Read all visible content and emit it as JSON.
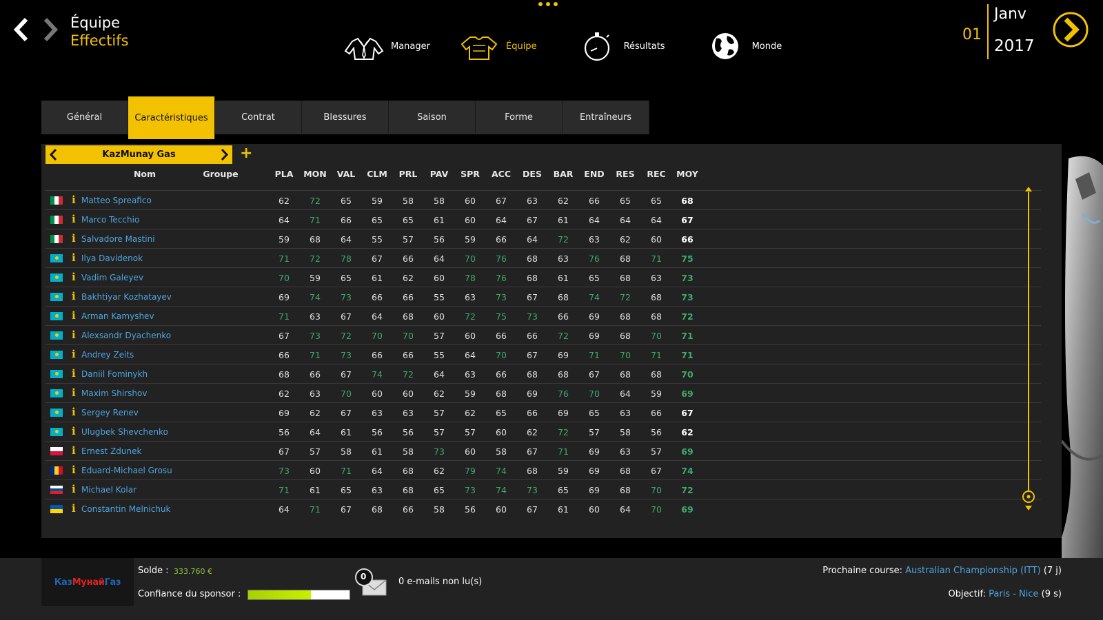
{
  "header": {
    "title": "Équipe",
    "subtitle": "Effectifs",
    "date": {
      "day": "01",
      "month": "Janv",
      "year": "2017"
    }
  },
  "mainnav": [
    {
      "label": "Manager",
      "icon": "manager-icon"
    },
    {
      "label": "Équipe",
      "icon": "jersey-icon",
      "active": true
    },
    {
      "label": "Résultats",
      "icon": "stopwatch-icon"
    },
    {
      "label": "Monde",
      "icon": "globe-icon"
    }
  ],
  "tabs": [
    "Général",
    "Caractéristiques",
    "Contrat",
    "Blessures",
    "Saison",
    "Forme",
    "Entraîneurs"
  ],
  "active_tab": "Caractéristiques",
  "team": {
    "name": "KazMunay Gas"
  },
  "table": {
    "columns": [
      "Nom",
      "Groupe",
      "PLA",
      "MON",
      "VAL",
      "CLM",
      "PRL",
      "PAV",
      "SPR",
      "ACC",
      "DES",
      "BAR",
      "END",
      "RES",
      "REC",
      "MOY"
    ],
    "rows": [
      {
        "flag": "it",
        "name": "Matteo Spreafico",
        "v": [
          62,
          72,
          65,
          59,
          58,
          58,
          60,
          67,
          63,
          62,
          66,
          65,
          65,
          68
        ],
        "hi": [
          0,
          1,
          0,
          0,
          0,
          0,
          0,
          0,
          0,
          0,
          0,
          0,
          0,
          0
        ]
      },
      {
        "flag": "it",
        "name": "Marco Tecchio",
        "v": [
          64,
          71,
          66,
          65,
          65,
          61,
          60,
          64,
          67,
          61,
          64,
          64,
          64,
          67
        ],
        "hi": [
          0,
          1,
          0,
          0,
          0,
          0,
          0,
          0,
          0,
          0,
          0,
          0,
          0,
          0
        ]
      },
      {
        "flag": "it",
        "name": "Salvadore Mastini",
        "v": [
          59,
          68,
          64,
          55,
          57,
          56,
          59,
          66,
          64,
          72,
          63,
          62,
          60,
          66
        ],
        "hi": [
          0,
          0,
          0,
          0,
          0,
          0,
          0,
          0,
          0,
          1,
          0,
          0,
          0,
          0
        ]
      },
      {
        "flag": "kz",
        "name": "Ilya Davidenok",
        "v": [
          71,
          72,
          78,
          67,
          66,
          64,
          70,
          76,
          68,
          63,
          76,
          68,
          71,
          75
        ],
        "hi": [
          1,
          1,
          1,
          0,
          0,
          0,
          1,
          1,
          0,
          0,
          1,
          0,
          1,
          1
        ]
      },
      {
        "flag": "kz",
        "name": "Vadim Galeyev",
        "v": [
          70,
          59,
          65,
          61,
          62,
          60,
          78,
          76,
          68,
          61,
          65,
          68,
          63,
          73
        ],
        "hi": [
          1,
          0,
          0,
          0,
          0,
          0,
          1,
          1,
          0,
          0,
          0,
          0,
          0,
          1
        ]
      },
      {
        "flag": "kz",
        "name": "Bakhtiyar Kozhatayev",
        "v": [
          69,
          74,
          73,
          66,
          66,
          55,
          63,
          73,
          67,
          68,
          74,
          72,
          68,
          73
        ],
        "hi": [
          0,
          1,
          1,
          0,
          0,
          0,
          0,
          1,
          0,
          0,
          1,
          1,
          0,
          1
        ]
      },
      {
        "flag": "kz",
        "name": "Arman Kamyshev",
        "v": [
          71,
          63,
          67,
          64,
          68,
          60,
          72,
          75,
          73,
          66,
          69,
          68,
          68,
          72
        ],
        "hi": [
          1,
          0,
          0,
          0,
          0,
          0,
          1,
          1,
          1,
          0,
          0,
          0,
          0,
          1
        ]
      },
      {
        "flag": "kz",
        "name": "Alexsandr Dyachenko",
        "v": [
          67,
          73,
          72,
          70,
          70,
          57,
          60,
          66,
          66,
          72,
          69,
          68,
          70,
          71
        ],
        "hi": [
          0,
          1,
          1,
          1,
          1,
          0,
          0,
          0,
          0,
          1,
          0,
          0,
          1,
          1
        ]
      },
      {
        "flag": "kz",
        "name": "Andrey Zeits",
        "v": [
          66,
          71,
          73,
          66,
          66,
          55,
          64,
          70,
          67,
          69,
          71,
          70,
          71,
          71
        ],
        "hi": [
          0,
          1,
          1,
          0,
          0,
          0,
          0,
          1,
          0,
          0,
          1,
          1,
          1,
          1
        ]
      },
      {
        "flag": "kz",
        "name": "Daniil Fominykh",
        "v": [
          68,
          66,
          67,
          74,
          72,
          64,
          63,
          66,
          68,
          68,
          67,
          68,
          68,
          70
        ],
        "hi": [
          0,
          0,
          0,
          1,
          1,
          0,
          0,
          0,
          0,
          0,
          0,
          0,
          0,
          1
        ]
      },
      {
        "flag": "kz",
        "name": "Maxim Shirshov",
        "v": [
          62,
          63,
          70,
          60,
          60,
          62,
          59,
          68,
          69,
          76,
          70,
          64,
          59,
          69
        ],
        "hi": [
          0,
          0,
          1,
          0,
          0,
          0,
          0,
          0,
          0,
          1,
          1,
          0,
          0,
          1
        ]
      },
      {
        "flag": "kz",
        "name": "Sergey Renev",
        "v": [
          69,
          62,
          67,
          63,
          63,
          57,
          62,
          65,
          66,
          69,
          65,
          63,
          66,
          67
        ],
        "hi": [
          0,
          0,
          0,
          0,
          0,
          0,
          0,
          0,
          0,
          0,
          0,
          0,
          0,
          0
        ]
      },
      {
        "flag": "kz",
        "name": "Ulugbek Shevchenko",
        "v": [
          56,
          64,
          61,
          56,
          56,
          57,
          57,
          60,
          62,
          72,
          57,
          58,
          56,
          62
        ],
        "hi": [
          0,
          0,
          0,
          0,
          0,
          0,
          0,
          0,
          0,
          1,
          0,
          0,
          0,
          0
        ]
      },
      {
        "flag": "pl",
        "name": "Ernest Zdunek",
        "v": [
          67,
          57,
          58,
          61,
          58,
          73,
          60,
          58,
          67,
          71,
          69,
          63,
          57,
          69
        ],
        "hi": [
          0,
          0,
          0,
          0,
          0,
          1,
          0,
          0,
          0,
          1,
          0,
          0,
          0,
          1
        ]
      },
      {
        "flag": "ro",
        "name": "Eduard-Michael Grosu",
        "v": [
          73,
          60,
          71,
          64,
          68,
          62,
          79,
          74,
          68,
          59,
          69,
          68,
          67,
          74
        ],
        "hi": [
          1,
          0,
          1,
          0,
          0,
          0,
          1,
          1,
          0,
          0,
          0,
          0,
          0,
          1
        ]
      },
      {
        "flag": "si",
        "name": "Michael Kolar",
        "v": [
          71,
          61,
          65,
          63,
          68,
          65,
          73,
          74,
          73,
          65,
          69,
          68,
          70,
          72
        ],
        "hi": [
          1,
          0,
          0,
          0,
          0,
          0,
          1,
          1,
          1,
          0,
          0,
          0,
          1,
          1
        ]
      },
      {
        "flag": "ua",
        "name": "Constantin Melnichuk",
        "v": [
          64,
          71,
          67,
          68,
          66,
          58,
          56,
          60,
          67,
          61,
          60,
          64,
          70,
          69
        ],
        "hi": [
          0,
          1,
          0,
          0,
          0,
          0,
          0,
          0,
          0,
          0,
          0,
          0,
          1,
          1
        ]
      }
    ]
  },
  "footer": {
    "sponsor_logo_a": "Каз",
    "sponsor_logo_b": "Мунай",
    "sponsor_logo_c": "Газ",
    "solde_label": "Solde :",
    "solde_value": "333.760 €",
    "confidence_label": "Confiance du sponsor :",
    "confidence_level": 0.62,
    "mail_count": "0",
    "mail_text": "0 e-mails non lu(s)",
    "next_race_label": "Prochaine course:",
    "next_race_link": "Australian Championship (ITT)",
    "next_race_delay": "(7 j)",
    "objective_label": "Objectif:",
    "objective_link": "Paris - Nice",
    "objective_delay": "(9 s)"
  },
  "colors": {
    "accent": "#f2c200",
    "link": "#4ea5e0",
    "highlight": "#3fa870"
  }
}
